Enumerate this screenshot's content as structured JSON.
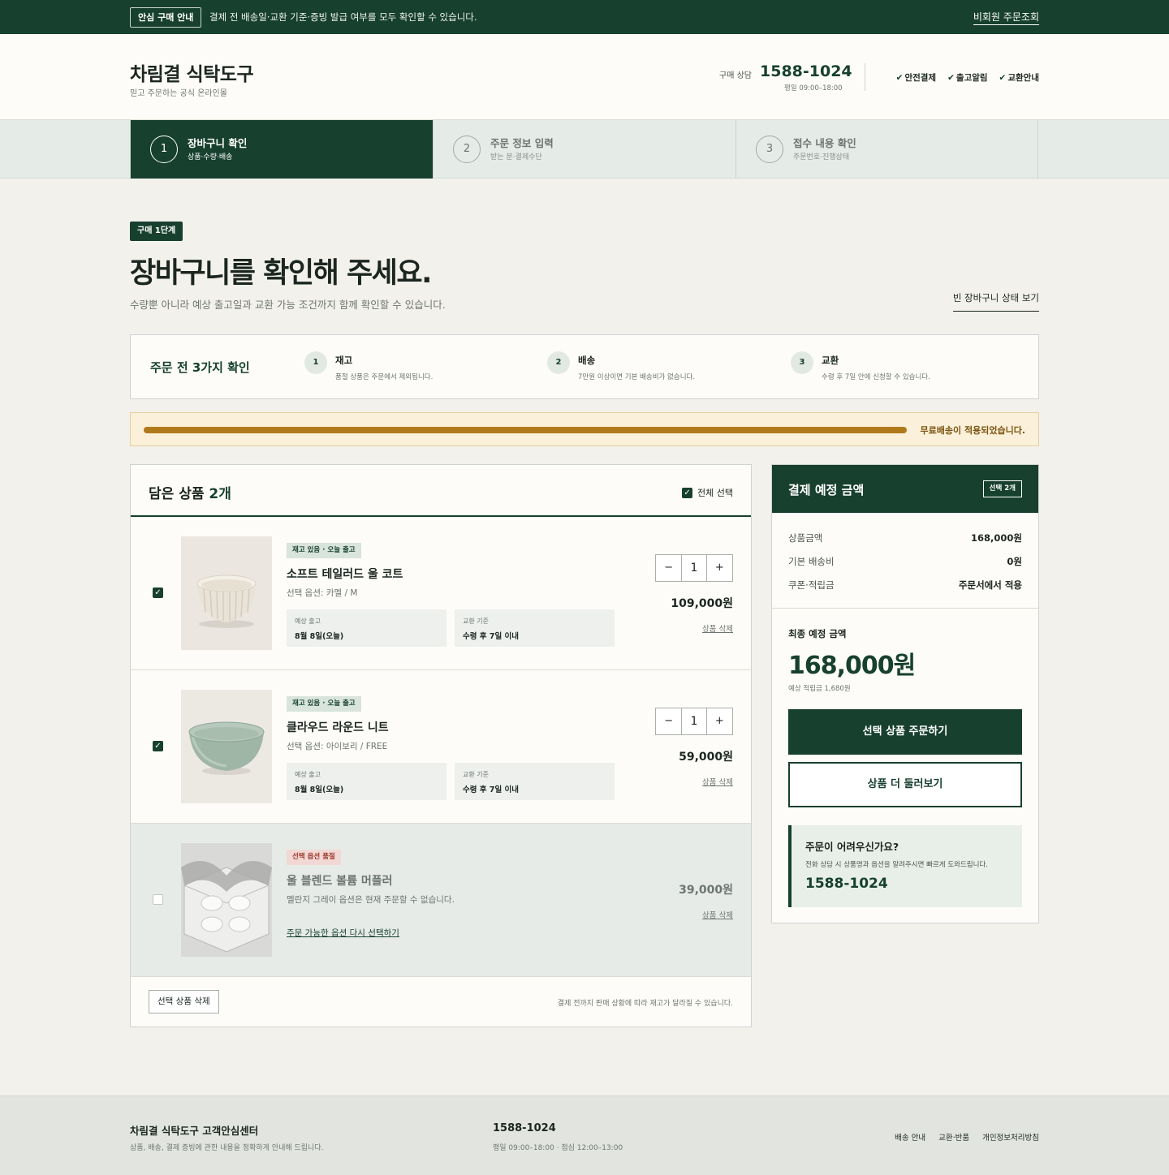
{
  "topbar": {
    "badge": "안심 구매 안내",
    "message": "결제 전 배송일·교환 기준·증빙 발급 여부를 모두 확인할 수 있습니다.",
    "order_lookup": "비회원 주문조회"
  },
  "header": {
    "brand": "차림결 식탁도구",
    "brand_sub": "믿고 주문하는 공식 온라인몰",
    "phone_label": "구매 상담",
    "phone": "1588-1024",
    "hours": "평일 09:00–18:00",
    "checks": [
      "안전결제",
      "출고알림",
      "교환안내"
    ]
  },
  "steps": [
    {
      "num": "1",
      "title": "장바구니 확인",
      "sub": "상품·수량·배송",
      "active": true
    },
    {
      "num": "2",
      "title": "주문 정보 입력",
      "sub": "받는 분·결제수단",
      "active": false
    },
    {
      "num": "3",
      "title": "접수 내용 확인",
      "sub": "주문번호·진행상태",
      "active": false
    }
  ],
  "page": {
    "stage_badge": "구매 1단계",
    "title": "장바구니를 확인해 주세요.",
    "subtitle": "수량뿐 아니라 예상 출고일과 교환 가능 조건까지 함께 확인할 수 있습니다.",
    "empty_link": "빈 장바구니 상태 보기"
  },
  "check_panel": {
    "title": "주문 전 3가지 확인",
    "items": [
      {
        "num": "1",
        "title": "재고",
        "desc": "품절 상품은 주문에서 제외됩니다."
      },
      {
        "num": "2",
        "title": "배송",
        "desc": "7만원 이상이면 기본 배송비가 없습니다."
      },
      {
        "num": "3",
        "title": "교환",
        "desc": "수령 후 7일 안에 신청할 수 있습니다."
      }
    ]
  },
  "shipping": {
    "progress": 1.0,
    "message": "무료배송이 적용되었습니다.",
    "color": "#b07a1c"
  },
  "cart": {
    "title_prefix": "담은 상품",
    "title_count": "2개",
    "select_all": "전체 선택",
    "items": [
      {
        "tag": "재고 있음 · 오늘 출고",
        "name": "소프트 테일러드 울 코트",
        "option": "선택 옵션: 카멜 / M",
        "ship_label": "예상 출고",
        "ship_value": "8월 8일(오늘)",
        "exchange_label": "교환 기준",
        "exchange_value": "수령 후 7일 이내",
        "qty": "1",
        "price": "109,000원",
        "delete": "상품 삭제",
        "checked": true
      },
      {
        "tag": "재고 있음 · 오늘 출고",
        "name": "클라우드 라운드 니트",
        "option": "선택 옵션: 아이보리 / FREE",
        "ship_label": "예상 출고",
        "ship_value": "8월 8일(오늘)",
        "exchange_label": "교환 기준",
        "exchange_value": "수령 후 7일 이내",
        "qty": "1",
        "price": "59,000원",
        "delete": "상품 삭제",
        "checked": true
      },
      {
        "tag": "선택 옵션 품절",
        "name": "울 블렌드 볼륨 머플러",
        "option": "멜란지 그레이 옵션은 현재 주문할 수 없습니다.",
        "reselect": "주문 가능한 옵션 다시 선택하기",
        "price": "39,000원",
        "delete": "상품 삭제",
        "checked": false
      }
    ],
    "delete_selected": "선택 상품 삭제",
    "footnote": "결제 전까지 판매 상황에 따라 재고가 달라질 수 있습니다."
  },
  "summary": {
    "title": "결제 예정 금액",
    "badge": "선택 2개",
    "lines": [
      {
        "label": "상품금액",
        "value": "168,000원"
      },
      {
        "label": "기본 배송비",
        "value": "0원"
      },
      {
        "label": "쿠폰·적립금",
        "value": "주문서에서 적용"
      }
    ],
    "final_label": "최종 예정 금액",
    "final_amount": "168,000원",
    "points": "예상 적립금 1,680원",
    "order_button": "선택 상품 주문하기",
    "browse_button": "상품 더 둘러보기",
    "help_title": "주문이 어려우신가요?",
    "help_desc": "전화 상담 시 상품명과 옵션을 알려주시면 빠르게 도와드립니다.",
    "help_phone": "1588-1024"
  },
  "footer": {
    "center": "차림결 식탁도구 고객안심센터",
    "desc": "상품, 배송, 결제 증빙에 관한 내용을 정확하게 안내해 드립니다.",
    "phone": "1588-1024",
    "hours": "평일 09:00–18:00 · 점심 12:00–13:00",
    "links": [
      "배송 안내",
      "교환·반품",
      "개인정보처리방침"
    ]
  },
  "colors": {
    "primary": "#17402f",
    "background": "#f3f1eb",
    "accent": "#b07a1c"
  }
}
